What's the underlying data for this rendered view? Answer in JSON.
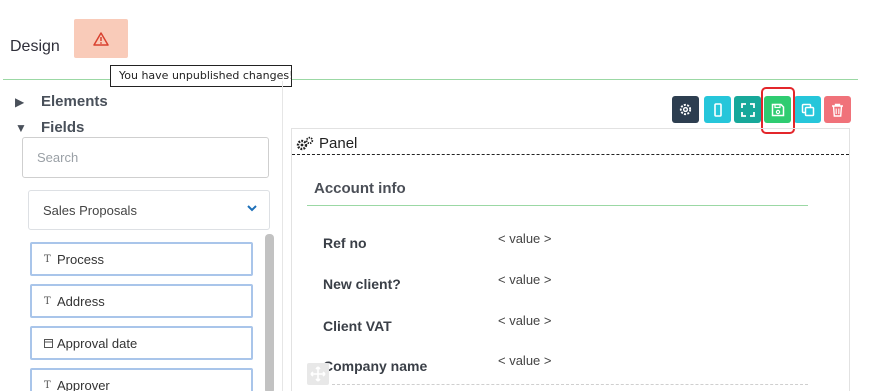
{
  "header": {
    "title": "Design",
    "warning_icon": "warning-triangle-icon",
    "tooltip": "You have unpublished changes!"
  },
  "sidebar": {
    "elements_label": "Elements",
    "fields_label": "Fields",
    "search_placeholder": "Search",
    "select_value": "Sales Proposals",
    "fields": [
      {
        "label": "Process",
        "icon": "text-type-icon"
      },
      {
        "label": "Address",
        "icon": "text-type-icon"
      },
      {
        "label": "Approval date",
        "icon": "calendar-icon"
      },
      {
        "label": "Approver",
        "icon": "text-type-icon"
      }
    ]
  },
  "toolbar": {
    "buttons": [
      {
        "name": "settings",
        "icon": "gear-icon",
        "color": "#2d3e50"
      },
      {
        "name": "mobile-preview",
        "icon": "mobile-icon",
        "color": "#26c6da"
      },
      {
        "name": "fullscreen",
        "icon": "expand-icon",
        "color": "#17a89a"
      },
      {
        "name": "save",
        "icon": "save-icon",
        "color": "#2fcc71"
      },
      {
        "name": "duplicate",
        "icon": "copy-icon",
        "color": "#26c6da"
      },
      {
        "name": "delete",
        "icon": "trash-icon",
        "color": "#f0727a"
      }
    ]
  },
  "panel": {
    "title": "Panel",
    "section_title": "Account info",
    "rows": [
      {
        "label": "Ref no",
        "value": "< value >"
      },
      {
        "label": "New client?",
        "value": "< value >"
      },
      {
        "label": "Client VAT",
        "value": "< value >"
      },
      {
        "label": "Company name",
        "value": "< value >"
      }
    ]
  }
}
